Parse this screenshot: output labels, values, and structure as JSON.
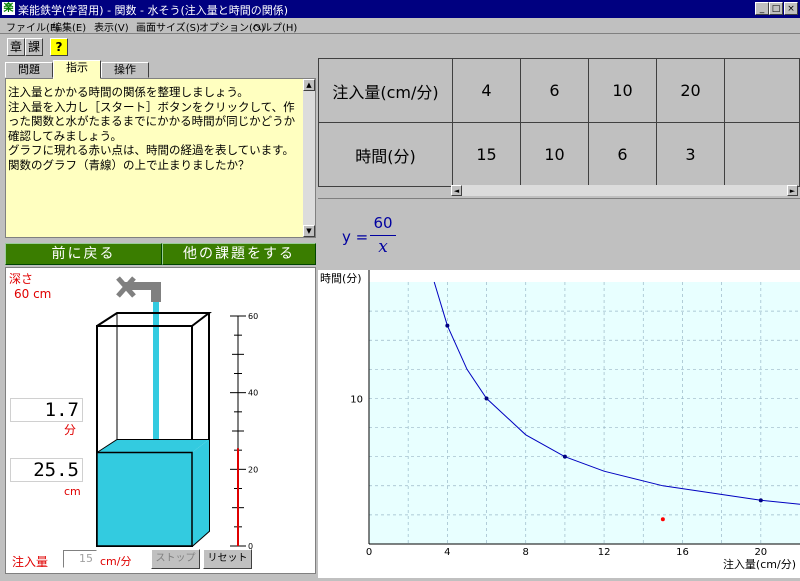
{
  "window": {
    "title": "楽能鉄学(学習用) - 関数 - 水そう(注入量と時間の関係)",
    "app_icon": "楽",
    "minimize": "_",
    "maximize": "□",
    "close": "×"
  },
  "menu": [
    "ファイル(F)",
    "編集(E)",
    "表示(V)",
    "画面サイズ(S)",
    "オプション(O)",
    "ヘルプ(H)"
  ],
  "toolbar": {
    "chapter": "章",
    "lesson": "課",
    "hint": "?"
  },
  "tabs": [
    "問題",
    "指示",
    "操作"
  ],
  "instructions": "注入量とかかる時間の関係を整理しましょう。\n注入量を入力し［スタート］ボタンをクリックして、作った関数と水がたまるまでにかかる時間が同じかどうか確認してみましょう。\nグラフに現れる赤い点は、時間の経過を表しています。\n関数のグラフ（青線）の上で止まりましたか？",
  "nav": {
    "back": "前に戻る",
    "other": "他の課題をする"
  },
  "tank": {
    "depth_label": "深さ",
    "depth_value": "60 cm",
    "time_value": "1.7",
    "time_unit": "分",
    "level_value": "25.5",
    "level_unit": "cm",
    "level_fraction": 0.425,
    "scale_ticks": [
      "60",
      "40",
      "20",
      "0"
    ],
    "flow_label": "注入量",
    "flow_value": "15",
    "flow_unit": "cm/分",
    "stop_button": "ストップ",
    "reset_button": "リセット",
    "water_color": "#33cbe0"
  },
  "table": {
    "row1_header": "注入量(cm/分)",
    "row2_header": "時間(分)",
    "flow": [
      "4",
      "6",
      "10",
      "20",
      ""
    ],
    "time": [
      "15",
      "10",
      "6",
      "3",
      ""
    ]
  },
  "formula": {
    "lhs": "y =",
    "numerator": "60",
    "denominator": "x"
  },
  "chart_data": {
    "type": "line",
    "xlabel": "注入量(cm/分)",
    "ylabel": "時間(分)",
    "xlim": [
      0,
      22
    ],
    "ylim": [
      0,
      18
    ],
    "x_ticks": [
      "0",
      "4",
      "8",
      "12",
      "16",
      "20"
    ],
    "y_ticks": [
      "10"
    ],
    "grid": true,
    "series": [
      {
        "type": "line",
        "color": "#0000c0",
        "x": [
          3.33,
          4,
          5,
          6,
          8,
          10,
          12,
          15,
          20,
          22
        ],
        "y": [
          18,
          15,
          12,
          10,
          7.5,
          6,
          5,
          4,
          3,
          2.73
        ]
      },
      {
        "type": "scatter",
        "color": "#000080",
        "x": [
          4,
          6,
          10,
          20
        ],
        "y": [
          15,
          10,
          6,
          3
        ]
      },
      {
        "type": "scatter",
        "color": "#ff0000",
        "x": [
          15
        ],
        "y": [
          1.7
        ]
      }
    ]
  }
}
